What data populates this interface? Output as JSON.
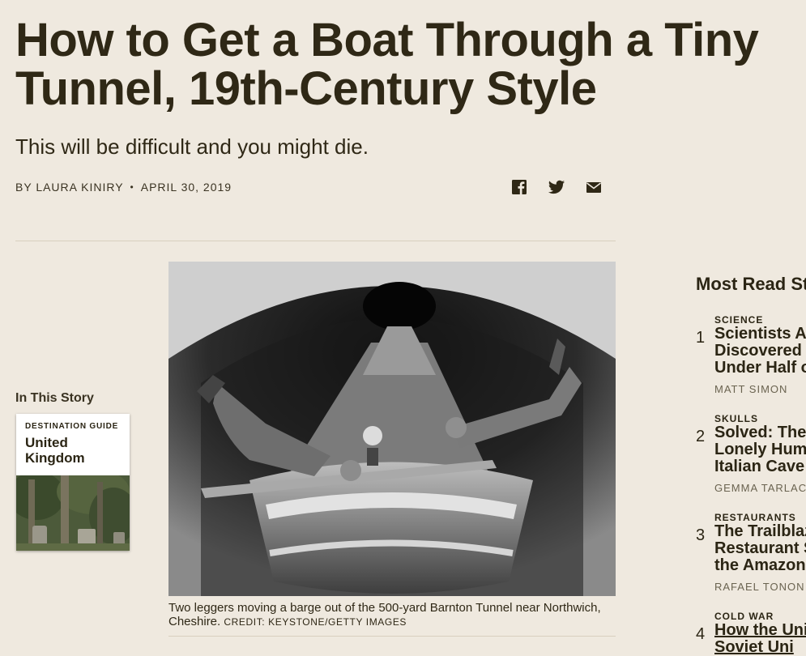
{
  "article": {
    "title": "How to Get a Boat Through a Tiny Tunnel, 19th-Century Style",
    "dek": "This will be difficult and you might die.",
    "byline": "BY LAURA KINIRY",
    "date": "APRIL 30, 2019",
    "share": [
      "facebook-icon",
      "twitter-icon",
      "email-icon"
    ],
    "caption": "Two leggers moving a barge out of the 500-yard Barnton Tunnel near Northwich, Cheshire.",
    "credit": "CREDIT: KEYSTONE/GETTY IMAGES"
  },
  "in_this_story": {
    "label": "In This Story",
    "card_tag": "DESTINATION GUIDE",
    "card_name": "United Kingdom"
  },
  "most_read": {
    "heading": "Most Read St",
    "items": [
      {
        "num": "1",
        "category": "SCIENCE",
        "headline": "Scientists Ac\nDiscovered S\nUnder Half o",
        "author": "MATT SIMON"
      },
      {
        "num": "2",
        "category": "SKULLS",
        "headline": "Solved: The\nLonely Huma\nItalian Cave",
        "author": "GEMMA TARLACH"
      },
      {
        "num": "3",
        "category": "RESTAURANTS",
        "headline": "The Trailblaz\nRestaurant S\nthe Amazon",
        "author": "RAFAEL TONON"
      },
      {
        "num": "4",
        "category": "COLD WAR",
        "headline": "How the Uni\nSoviet Uni",
        "author": ""
      }
    ]
  },
  "colors": {
    "background": "#efe9df",
    "text": "#2f2816"
  }
}
